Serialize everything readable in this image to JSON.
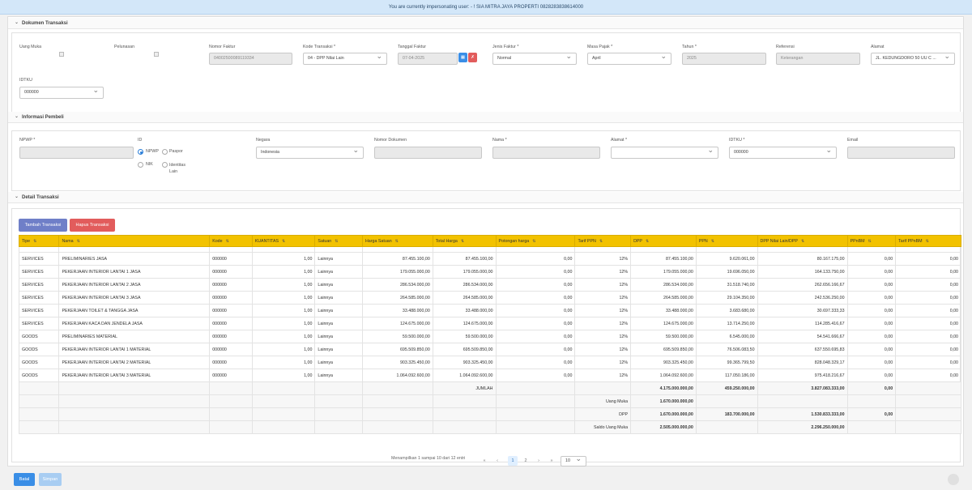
{
  "banner": {
    "text": "You are currently impersonating user:  - ! SIA MITRA JAYA PROPERTI 0828283838614000"
  },
  "dokumen": {
    "title": "Dokumen Transaksi",
    "uang_muka_label": "Uang Muka",
    "pelunasan_label": "Pelunasan",
    "nomor_faktur_label": "Nomor Faktur",
    "nomor_faktur": "04002500089119334",
    "kode_transaksi_label": "Kode Transaksi *",
    "kode_transaksi": "04 - DPP Nilai Lain",
    "tanggal_faktur_label": "Tanggal Faktur",
    "tanggal_faktur": "07-04-2025",
    "jenis_faktur_label": "Jenis Faktur *",
    "jenis_faktur": "Normal",
    "masa_pajak_label": "Masa Pajak *",
    "masa_pajak": "April",
    "tahun_label": "Tahun *",
    "tahun": "2025",
    "referensi_label": "Referensi",
    "referensi_placeholder": "Keterangan",
    "alamat_label": "Alamat",
    "alamat": "JL. KEDUNGDORO 50 UU C ...",
    "idtku_label": "IDTKU",
    "idtku": "000000"
  },
  "pembeli": {
    "title": "Informasi Pembeli",
    "npwp_label": "NPWP *",
    "id_label": "ID",
    "id_options": [
      "NPWP",
      "Paspor",
      "NIK",
      "Identitas Lain"
    ],
    "negara_label": "Negara",
    "negara": "Indonesia",
    "nomor_dokumen_label": "Nomor Dokumen",
    "nama_label": "Nama *",
    "alamat_label": "Alamat *",
    "idtku_label": "IDTKU *",
    "idtku": "000000",
    "email_label": "Email"
  },
  "detail": {
    "title": "Detail Transaksi",
    "add_button": "Tambah Transaksi",
    "delete_button": "Hapus Transaksi",
    "columns": [
      "Tipe",
      "Nama",
      "Kode",
      "KUANTITAS",
      "Satuan",
      "Harga Satuan",
      "Total Harga",
      "Potongan harga",
      "Tarif PPN",
      "DPP",
      "PPN",
      "DPP Nilai Lain/DPP",
      "PPnBM",
      "Tarif PPnBM"
    ],
    "rows": [
      [
        "SERVICES",
        "PRELIMINARIES JASA",
        "000000",
        "1,00",
        "Lainnya",
        "87.455.100,00",
        "87.455.100,00",
        "0,00",
        "12%",
        "87.455.100,00",
        "9.620.061,00",
        "80.167.175,00",
        "0,00",
        "0,00"
      ],
      [
        "SERVICES",
        "PEKERJAAN INTERIOR LANTAI 1 JASA",
        "000000",
        "1,00",
        "Lainnya",
        "179.055.000,00",
        "179.055.000,00",
        "0,00",
        "12%",
        "179.055.000,00",
        "19.696.050,00",
        "164.133.750,00",
        "0,00",
        "0,00"
      ],
      [
        "SERVICES",
        "PEKERJAAN INTERIOR LANTAI 2 JASA",
        "000000",
        "1,00",
        "Lainnya",
        "286.534.000,00",
        "286.534.000,00",
        "0,00",
        "12%",
        "286.534.000,00",
        "31.518.740,00",
        "262.656.166,67",
        "0,00",
        "0,00"
      ],
      [
        "SERVICES",
        "PEKERJAAN INTERIOR LANTAI 3 JASA",
        "000000",
        "1,00",
        "Lainnya",
        "264.585.000,00",
        "264.585.000,00",
        "0,00",
        "12%",
        "264.585.000,00",
        "29.104.350,00",
        "242.536.250,00",
        "0,00",
        "0,00"
      ],
      [
        "SERVICES",
        "PEKERJAAN TOILET & TANGGA JASA",
        "000000",
        "1,00",
        "Lainnya",
        "33.488.000,00",
        "33.488.000,00",
        "0,00",
        "12%",
        "33.488.000,00",
        "3.683.680,00",
        "30.697.333,33",
        "0,00",
        "0,00"
      ],
      [
        "SERVICES",
        "PEKERJAAN KACA DAN JENDELA JASA",
        "000000",
        "1,00",
        "Lainnya",
        "124.675.000,00",
        "124.675.000,00",
        "0,00",
        "12%",
        "124.675.000,00",
        "13.714.250,00",
        "114.285.416,67",
        "0,00",
        "0,00"
      ],
      [
        "GOODS",
        "PRELIMINARIES MATERIAL",
        "000000",
        "1,00",
        "Lainnya",
        "59.500.000,00",
        "59.500.000,00",
        "0,00",
        "12%",
        "59.500.000,00",
        "6.545.000,00",
        "54.541.666,67",
        "0,00",
        "0,00"
      ],
      [
        "GOODS",
        "PEKERJAAN INTERIOR LANTAI 1 MATERIAL",
        "000000",
        "1,00",
        "Lainnya",
        "695.509.850,00",
        "695.509.850,00",
        "0,00",
        "12%",
        "695.509.850,00",
        "76.506.083,50",
        "637.550.695,83",
        "0,00",
        "0,00"
      ],
      [
        "GOODS",
        "PEKERJAAN INTERIOR LANTAI 2 MATERIAL",
        "000000",
        "1,00",
        "Lainnya",
        "903.325.450,00",
        "903.325.450,00",
        "0,00",
        "12%",
        "903.325.450,00",
        "99.365.799,50",
        "828.048.329,17",
        "0,00",
        "0,00"
      ],
      [
        "GOODS",
        "PEKERJAAN INTERIOR LANTAI 3 MATERIAL",
        "000000",
        "1,00",
        "Lainnya",
        "1.064.092.600,00",
        "1.064.092.600,00",
        "0,00",
        "12%",
        "1.064.092.600,00",
        "117.050.186,00",
        "975.418.216,67",
        "0,00",
        "0,00"
      ]
    ],
    "summary": {
      "jumlah_label": "JUMLAH",
      "jumlah_dpp": "4.175.000.000,00",
      "jumlah_ppn": "459.250.000,00",
      "jumlah_dpp_lain": "3.827.083.333,00",
      "jumlah_ppnbm": "0,00",
      "uang_muka_label": "Uang Muka",
      "uang_muka_dpp": "1.670.000.000,00",
      "dpp_label": "DPP",
      "dpp_dpp": "1.670.000.000,00",
      "dpp_ppn": "183.700.000,00",
      "dpp_dpp_lain": "1.530.833.333,00",
      "dpp_ppnbm": "0,00",
      "saldo_label": "Saldo Uang Muka",
      "saldo_dpp": "2.505.000.000,00",
      "saldo_dpp_lain": "2.296.250.000,00"
    },
    "pagination": {
      "info": "Menampilkan 1 sampai 10 dari 12 entri",
      "pages": [
        "1",
        "2"
      ],
      "current": "1",
      "page_size": "10"
    }
  },
  "footer": {
    "batal": "Batal",
    "simpan": "Simpan"
  },
  "colors": {
    "primary": "#3a8ee6",
    "danger": "#e25c5c",
    "indigo": "#6f7fc8",
    "header_yellow": "#f2c200"
  }
}
